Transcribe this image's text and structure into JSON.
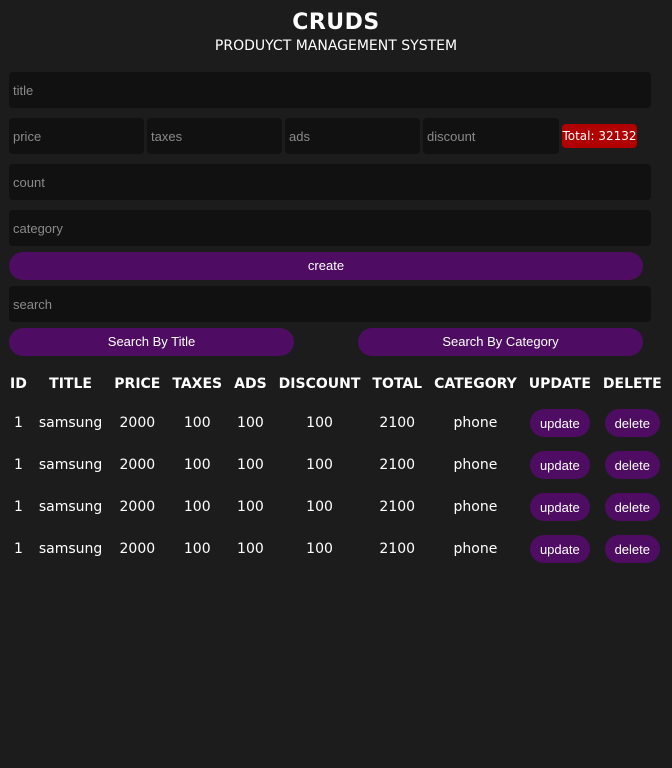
{
  "header": {
    "title": "CRUDS",
    "subtitle": "PRODUYCT MANAGEMENT SYSTEM"
  },
  "form": {
    "title_placeholder": "title",
    "price_placeholder": "price",
    "taxes_placeholder": "taxes",
    "ads_placeholder": "ads",
    "discount_placeholder": "discount",
    "total_label": "Total: 32132",
    "count_placeholder": "count",
    "category_placeholder": "category",
    "create_label": "create"
  },
  "search": {
    "placeholder": "search",
    "by_title_label": "Search By Title",
    "by_category_label": "Search By Category"
  },
  "table": {
    "columns": [
      "ID",
      "TITLE",
      "PRICE",
      "TAXES",
      "ADS",
      "DISCOUNT",
      "TOTAL",
      "CATEGORY",
      "UPDATE",
      "DELETE"
    ],
    "rows": [
      {
        "id": "1",
        "title": "samsung",
        "price": "2000",
        "taxes": "100",
        "ads": "100",
        "discount": "100",
        "total": "2100",
        "category": "phone",
        "update": "update",
        "delete": "delete"
      },
      {
        "id": "1",
        "title": "samsung",
        "price": "2000",
        "taxes": "100",
        "ads": "100",
        "discount": "100",
        "total": "2100",
        "category": "phone",
        "update": "update",
        "delete": "delete"
      },
      {
        "id": "1",
        "title": "samsung",
        "price": "2000",
        "taxes": "100",
        "ads": "100",
        "discount": "100",
        "total": "2100",
        "category": "phone",
        "update": "update",
        "delete": "delete"
      },
      {
        "id": "1",
        "title": "samsung",
        "price": "2000",
        "taxes": "100",
        "ads": "100",
        "discount": "100",
        "total": "2100",
        "category": "phone",
        "update": "update",
        "delete": "delete"
      }
    ]
  },
  "colors": {
    "background": "#1c1c1c",
    "input": "#111111",
    "button": "#4e0d63",
    "total_badge": "#b00000"
  }
}
